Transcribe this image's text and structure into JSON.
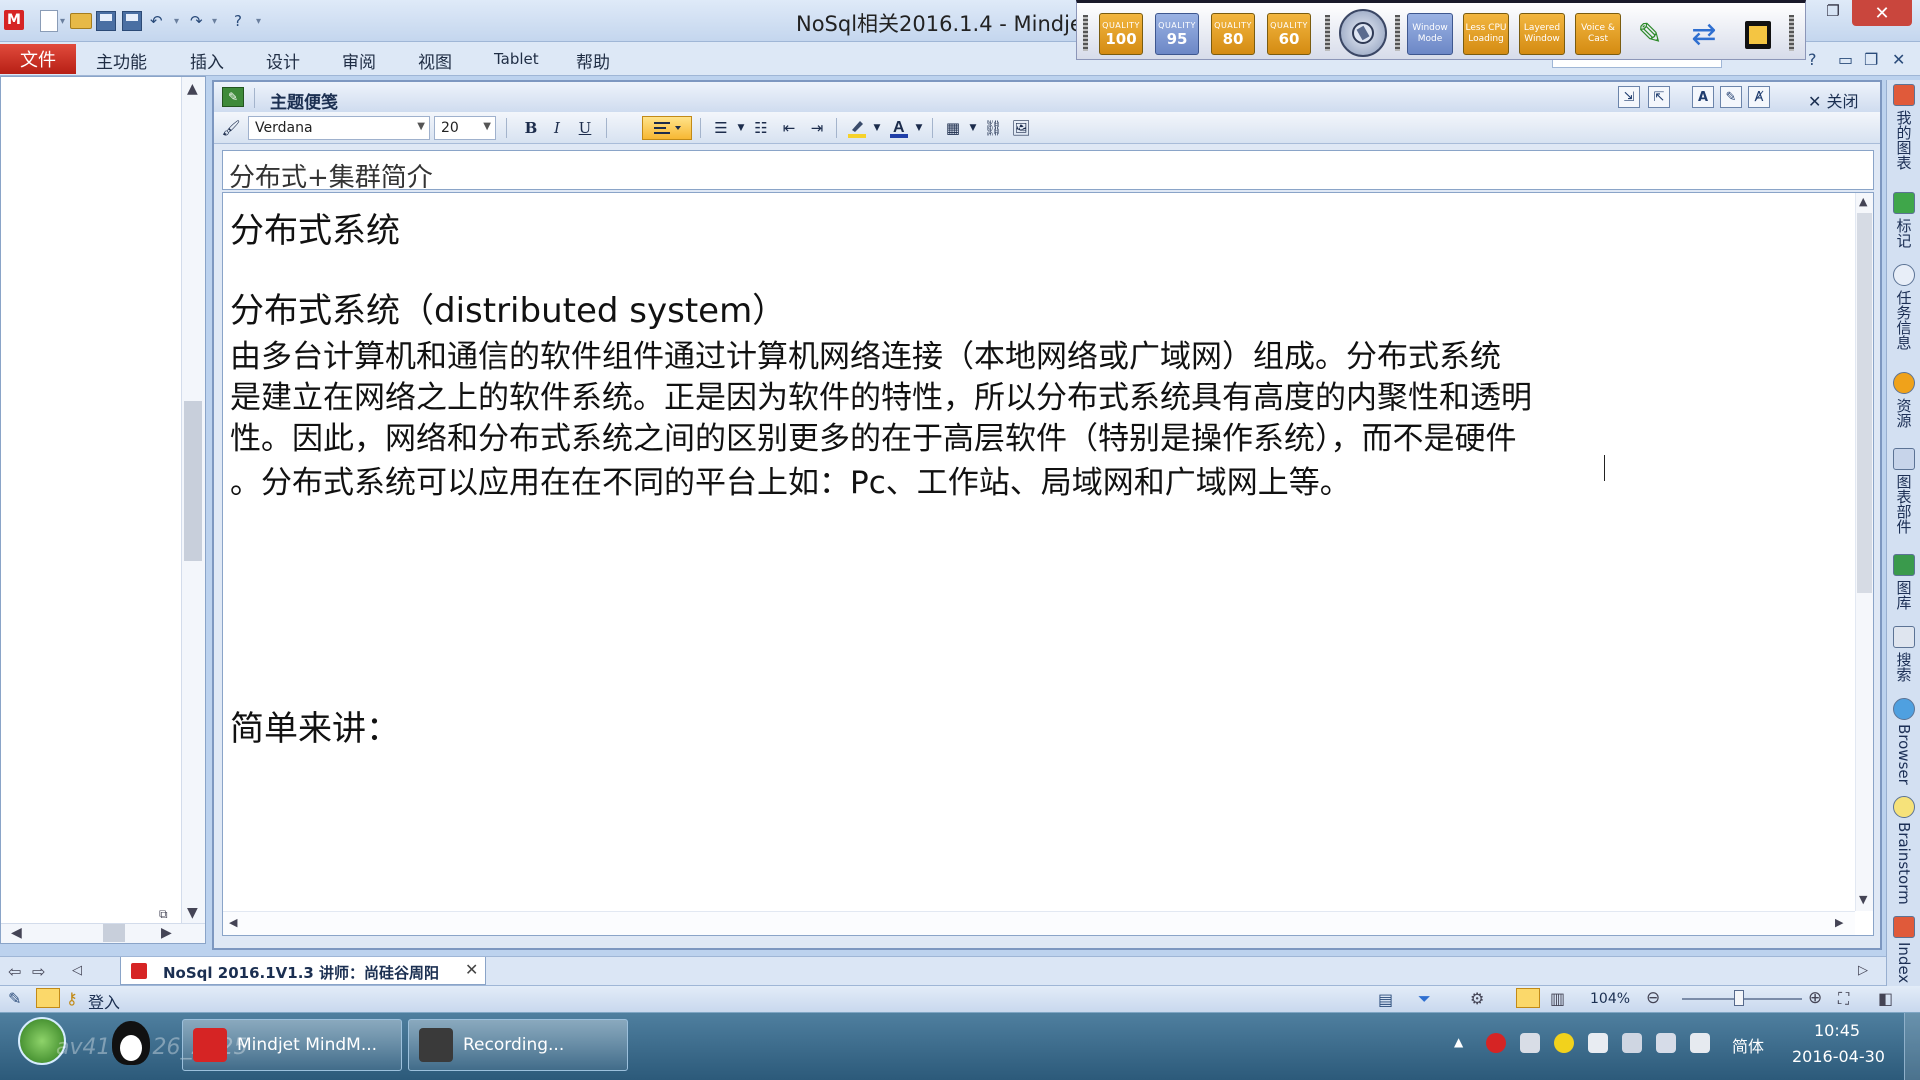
{
  "title_bar": {
    "window_title": "NoSql相关2016.1.4 - Mindje",
    "app_icon_letter": "M",
    "restore_glyph": "❐",
    "close_glyph": "✕"
  },
  "recorder_toolbar": {
    "quality_buttons": [
      {
        "caption": "QUALITY",
        "value": "100"
      },
      {
        "caption": "QUALITY",
        "value": "95"
      },
      {
        "caption": "QUALITY",
        "value": "80"
      },
      {
        "caption": "QUALITY",
        "value": "60"
      }
    ],
    "mode_buttons": [
      "Window Mode",
      "Less CPU Loading",
      "Layered Window",
      "Voice & Cast"
    ]
  },
  "ribbon": {
    "file_tab": "文件",
    "tabs": [
      "主功能",
      "插入",
      "设计",
      "审阅",
      "视图",
      "Tablet",
      "帮助"
    ]
  },
  "notes_panel": {
    "title": "主题便笺",
    "close_label": "✕ 关闭",
    "font_name": "Verdana",
    "font_size": "20",
    "bold_label": "B",
    "italic_label": "I",
    "underline_label": "U",
    "subject": "分布式+集群简介",
    "content": {
      "heading": "分布式系统",
      "subheading": "分布式系统（distributed system）",
      "lines": [
        " 由多台计算机和通信的软件组件通过计算机网络连接（本地网络或广域网）组成。分布式系统",
        "是建立在网络之上的软件系统。正是因为软件的特性，所以分布式系统具有高度的内聚性和透明",
        "性。因此，网络和分布式系统之间的区别更多的在于高层软件（特别是操作系统），而不是硬件",
        "。分布式系统可以应用在在不同的平台上如：Pc、工作站、局域网和广域网上等。"
      ],
      "closing": "简单来讲："
    }
  },
  "right_dock": {
    "items": [
      "我的图表",
      "标记",
      "任务信息",
      "资源",
      "图表部件",
      "图库",
      "搜索",
      "Browser",
      "Brainstorm",
      "Index"
    ]
  },
  "doc_tab": {
    "label": "NoSql 2016.1V1.3 讲师：尚硅谷周阳",
    "close_glyph": "✕"
  },
  "status_bar": {
    "login": "登入",
    "zoom": "104%"
  },
  "taskbar": {
    "watermark": "av4174126_2225",
    "tasks": [
      "Mindjet MindM...",
      "Recording..."
    ],
    "language": "简体",
    "time": "10:45",
    "date": "2016-04-30"
  },
  "colors": {
    "file_tab": "#c8291d",
    "quality_orange": "#e4a022",
    "quality_blue": "#7f97d2",
    "format_highlight": "#f7b733",
    "taskbar": "#3a6a8a"
  }
}
